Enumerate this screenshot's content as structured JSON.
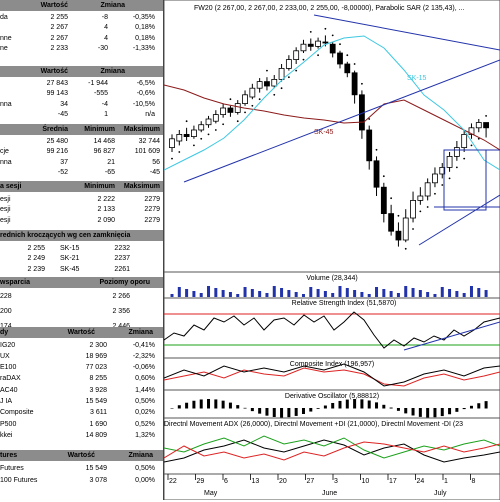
{
  "quotes": {
    "header": {
      "c1": "Wartość",
      "c2": "Zmiana"
    },
    "rows": [
      {
        "label": "da",
        "value": "2 255",
        "chg": "-8",
        "pct": "-0,35%"
      },
      {
        "label": "",
        "value": "2 267",
        "chg": "4",
        "pct": "0,18%"
      },
      {
        "label": "nne",
        "value": "2 267",
        "chg": "4",
        "pct": "0,18%"
      },
      {
        "label": "ne",
        "value": "2 233",
        "chg": "-30",
        "pct": "-1,33%"
      }
    ]
  },
  "volume": {
    "header": {
      "c1": "Wartość",
      "c2": "Zmiana"
    },
    "rows": [
      {
        "label": "",
        "value": "27 843",
        "chg": "-1 944",
        "pct": "-6,5%"
      },
      {
        "label": "",
        "value": "99 143",
        "chg": "-555",
        "pct": "-0,6%"
      },
      {
        "label": "nna",
        "value": "34",
        "chg": "-4",
        "pct": "-10,5%"
      },
      {
        "label": "",
        "value": "-45",
        "chg": "1",
        "pct": "n/a"
      }
    ]
  },
  "stats": {
    "header": {
      "c1": "Średnia",
      "c2": "Minimum",
      "c3": "Maksimum"
    },
    "rows": [
      {
        "label": "",
        "a": "25 480",
        "b": "14 468",
        "c": "32 744"
      },
      {
        "label": "cje",
        "a": "99 216",
        "b": "96 827",
        "c": "101 609"
      },
      {
        "label": "nna",
        "a": "37",
        "b": "21",
        "c": "56"
      },
      {
        "label": "",
        "a": "-52",
        "b": "-65",
        "c": "-45"
      }
    ]
  },
  "session": {
    "header": {
      "label": "a sesji",
      "c1": "Minimum",
      "c2": "Maksimum"
    },
    "rows": [
      {
        "label": "esji",
        "a": "2 222",
        "b": "2279"
      },
      {
        "label": "esji",
        "a": "2 133",
        "b": "2279"
      },
      {
        "label": "esji",
        "a": "2 090",
        "b": "2279"
      }
    ]
  },
  "ma": {
    "header": "rednich kroczących wg cen zamknięcia",
    "rows": [
      {
        "v1": "2 255",
        "n": "SK-15",
        "v2": "2232"
      },
      {
        "v1": "2 249",
        "n": "SK-21",
        "v2": "2237"
      },
      {
        "v1": "2 239",
        "n": "SK-45",
        "v2": "2261"
      }
    ]
  },
  "support": {
    "header": {
      "label": "wsparcia",
      "c1": "Poziomy oporu"
    },
    "rows": [
      {
        "v1": "228",
        "v2": "2 266"
      },
      {
        "v1": "200",
        "v2": "2 356"
      },
      {
        "v1": "174",
        "v2": "2 446"
      }
    ]
  },
  "indices": {
    "header": {
      "label": "dy",
      "c1": "Wartość",
      "c2": "Zmiana"
    },
    "rows": [
      {
        "label": "IG20",
        "value": "2 300",
        "pct": "-0,41%"
      },
      {
        "label": "UX",
        "value": "18 969",
        "pct": "-2,32%"
      },
      {
        "label": "E100",
        "value": "77 023",
        "pct": "-0,06%"
      },
      {
        "label": "raDAX",
        "value": "8 255",
        "pct": "0,60%"
      },
      {
        "label": "AC40",
        "value": "3 928",
        "pct": "1,44%"
      },
      {
        "label": "J IA",
        "value": "15 549",
        "pct": "0,50%"
      },
      {
        "label": "Composite",
        "value": "3 611",
        "pct": "0,02%"
      },
      {
        "label": "P500",
        "value": "1 690",
        "pct": "0,52%"
      },
      {
        "label": "kkei",
        "value": "14 809",
        "pct": "1,32%"
      }
    ]
  },
  "futures": {
    "header": {
      "label": "tures",
      "c1": "Wartość",
      "c2": "Zmiana"
    },
    "rows": [
      {
        "label": "Futures",
        "value": "15 549",
        "pct": "0,50%"
      },
      {
        "label": "100 Futures",
        "value": "3 078",
        "pct": "0,00%"
      }
    ]
  },
  "charts": {
    "main_title": "FW20 (2 267,00, 2 267,00, 2 233,00, 2 255,00, -8,00000), Parabolic SAR (2 135,43), ...",
    "main_labels": {
      "sk15": "SK-15",
      "sk45": "SK-45"
    },
    "volume_title": "Volume (28,344)",
    "rsi_title": "Relative Strength Index (51,5870)",
    "composite_title": "Composite Index (196,957)",
    "deriv_title": "Derivative Oscillator (5,88812)",
    "dmi_title": "Directnl Movement ADX (26,0000), Directnl Movement +DI (21,0000), Directnl Movement -DI (23",
    "dates": [
      "22",
      "29",
      "6",
      "13",
      "20",
      "27",
      "3",
      "10",
      "17",
      "24",
      "1",
      "8"
    ],
    "months": [
      "May",
      "June",
      "July"
    ],
    "colors": {
      "candle": "#000000",
      "sk15": "#3ec8e0",
      "sk45": "#8b1a1a",
      "trend": "#2233aa",
      "green": "#1aa01a",
      "red": "#dd2222"
    }
  }
}
